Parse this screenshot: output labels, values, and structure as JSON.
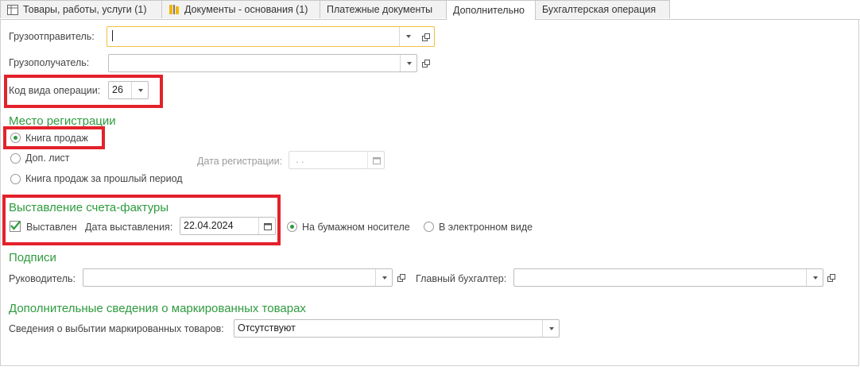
{
  "tabs": [
    {
      "label": "Товары, работы, услуги (1)",
      "icon": "table-icon"
    },
    {
      "label": "Документы - основания (1)",
      "icon": "document-basis-icon"
    },
    {
      "label": "Платежные документы",
      "icon": ""
    },
    {
      "label": "Дополнительно",
      "icon": ""
    },
    {
      "label": "Бухгалтерская операция",
      "icon": ""
    }
  ],
  "shipper": {
    "label": "Грузоотправитель:",
    "value": ""
  },
  "consignee": {
    "label": "Грузополучатель:",
    "value": ""
  },
  "operation_code": {
    "label": "Код вида операции:",
    "value": "26"
  },
  "registration": {
    "heading": "Место регистрации",
    "options": [
      "Книга продаж",
      "Доп. лист",
      "Книга продаж за прошлый период"
    ],
    "selected": "Книга продаж",
    "date_label": "Дата регистрации:",
    "date_value": " .  ."
  },
  "invoice": {
    "heading": "Выставление счета-фактуры",
    "issued_label": "Выставлен",
    "issued_checked": true,
    "date_label": "Дата выставления:",
    "date_value": "22.04.2024",
    "media_options": [
      "На бумажном носителе",
      "В электронном виде"
    ],
    "media_selected": "На бумажном носителе"
  },
  "signatures": {
    "heading": "Подписи",
    "head_label": "Руководитель:",
    "head_value": "",
    "accountant_label": "Главный бухгалтер:",
    "accountant_value": ""
  },
  "marking": {
    "heading": "Дополнительные сведения о маркированных товарах",
    "label": "Сведения о выбытии маркированных товаров:",
    "value": "Отсутствуют"
  },
  "colors": {
    "heading": "#2e9b3e",
    "highlight": "#e3212b",
    "focus_border": "#f0c040"
  }
}
